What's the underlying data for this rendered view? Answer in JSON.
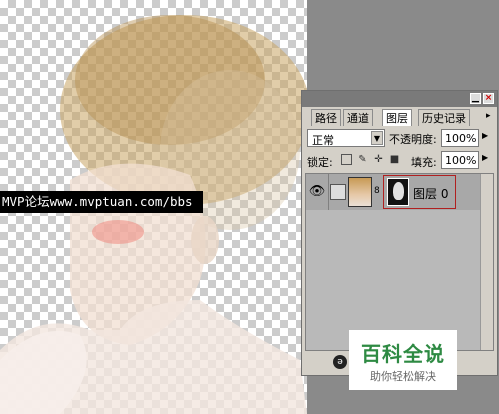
{
  "canvas": {
    "watermark": "MVP论坛www.mvptuan.com/bbs"
  },
  "layers_panel": {
    "window_buttons": {
      "minimize": "▁",
      "close": "×"
    },
    "tabs": [
      {
        "label": "路径"
      },
      {
        "label": "通道"
      },
      {
        "label": "图层"
      },
      {
        "label": "历史记录"
      }
    ],
    "tab_arrow": "▸",
    "blend_mode": "正常",
    "opacity_label": "不透明度:",
    "opacity_value": "100%",
    "lock_label": "锁定:",
    "lock_icons": [
      "transparency-lock-icon",
      "brush-lock-icon",
      "move-lock-icon",
      "padlock-icon"
    ],
    "fill_label": "填充:",
    "fill_value": "100%",
    "layer": {
      "name": "图层 0"
    },
    "bottom_icon": "ə"
  },
  "logo": {
    "title": "百科全说",
    "subtitle": "助你轻松解决"
  }
}
